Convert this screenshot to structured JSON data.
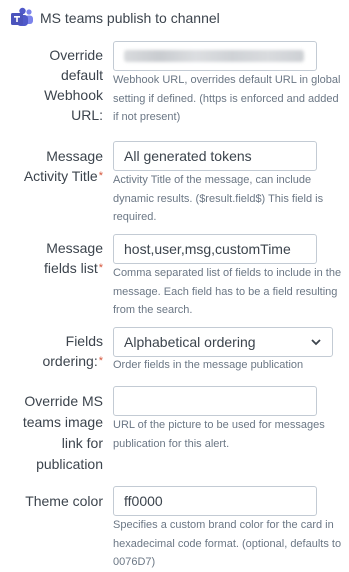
{
  "header": {
    "title": "MS teams publish to channel",
    "icon": "microsoft-teams-icon"
  },
  "fields": {
    "webhook": {
      "label_lines": [
        "Override",
        "default",
        "Webhook",
        "URL:"
      ],
      "value_blurred": true,
      "help": "Webhook URL, overrides default URL in global setting if defined. (https is enforced and added if not present)"
    },
    "activity_title": {
      "label_lines": [
        "Message",
        "Activity Title"
      ],
      "required": "*",
      "value": "All generated tokens",
      "help": "Activity Title of the message, can include dynamic results. ($result.field$) This field is required."
    },
    "fields_list": {
      "label_lines": [
        "Message",
        "fields list"
      ],
      "required": "*",
      "value": "host,user,msg,customTime",
      "help": "Comma separated list of fields to include in the message. Each field has to be a field resulting from the search."
    },
    "ordering": {
      "label_lines": [
        "Fields",
        "ordering:"
      ],
      "required": "*",
      "selected": "Alphabetical ordering",
      "help": "Order fields in the message publication"
    },
    "image_link": {
      "label_lines": [
        "Override MS",
        "teams image",
        "link for",
        "publication"
      ],
      "value": "",
      "help": "URL of the picture to be used for messages publication for this alert."
    },
    "theme_color": {
      "label_lines": [
        "Theme color"
      ],
      "value": "ff0000",
      "help": "Specifies a custom brand color for the card in hexadecimal code format. (optional, defaults to 0076D7)"
    }
  },
  "colors": {
    "required": "#d6563c",
    "teams_purple": "#5059c9"
  }
}
